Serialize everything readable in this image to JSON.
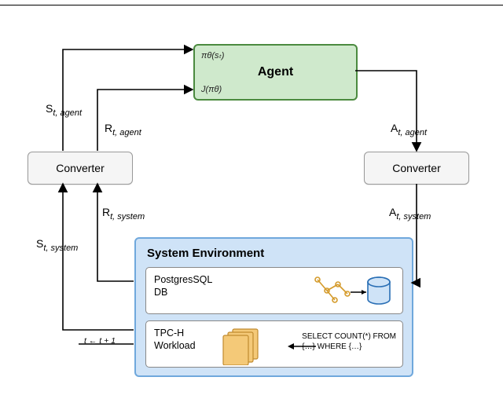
{
  "agent": {
    "title": "Agent",
    "policy": "πθ(sₜ)",
    "objective": "J(πθ)"
  },
  "converterLeft": {
    "label": "Converter"
  },
  "converterRight": {
    "label": "Converter"
  },
  "env": {
    "title": "System Environment",
    "db": {
      "label": "PostgresSQL\nDB"
    },
    "workload": {
      "label": "TPC-H\nWorkload",
      "snippet": "SELECT COUNT(*) FROM\n{…} WHERE {…}"
    }
  },
  "edges": {
    "s_agent": "S",
    "s_agent_sub": "t, agent",
    "r_agent": "R",
    "r_agent_sub": "t, agent",
    "a_agent": "A",
    "a_agent_sub": "t, agent",
    "s_system": "S",
    "s_system_sub": "t, system",
    "r_system": "R",
    "r_system_sub": "t, system",
    "a_system": "A",
    "a_system_sub": "t, system",
    "time_update": "t ← t + 1"
  }
}
